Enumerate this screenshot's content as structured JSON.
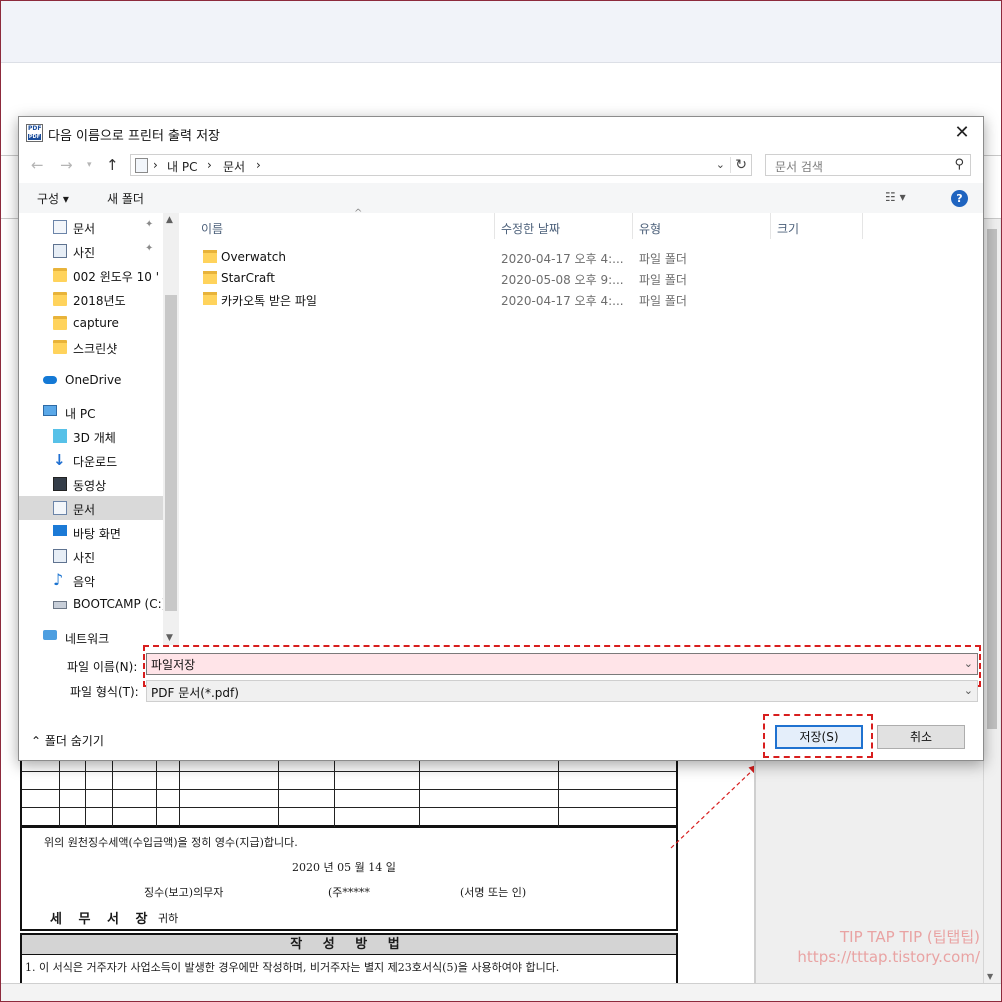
{
  "dialog": {
    "title": "다음 이름으로 프린터 출력 저장",
    "close_label": "✕"
  },
  "address": {
    "parts": [
      "내 PC",
      "문서"
    ],
    "search_placeholder": "문서 검색"
  },
  "cmdbar": {
    "organize": "구성 ▾",
    "new_folder": "새 폴더",
    "help": "?"
  },
  "nav": {
    "quick": [
      {
        "label": "문서",
        "icon": "document-icon",
        "pinned": true
      },
      {
        "label": "사진",
        "icon": "picture-icon",
        "pinned": true
      },
      {
        "label": "002 윈도우 10 '",
        "icon": "folder-icon"
      },
      {
        "label": "2018년도",
        "icon": "folder-icon"
      },
      {
        "label": "capture",
        "icon": "folder-icon"
      },
      {
        "label": "스크린샷",
        "icon": "folder-icon"
      }
    ],
    "onedrive": "OneDrive",
    "pc": "내 PC",
    "pc_items": [
      {
        "label": "3D 개체",
        "icon": "cube-icon"
      },
      {
        "label": "다운로드",
        "icon": "download-icon"
      },
      {
        "label": "동영상",
        "icon": "video-icon"
      },
      {
        "label": "문서",
        "icon": "document-icon",
        "selected": true
      },
      {
        "label": "바탕 화면",
        "icon": "desktop-icon"
      },
      {
        "label": "사진",
        "icon": "picture-icon"
      },
      {
        "label": "음악",
        "icon": "music-icon"
      },
      {
        "label": "BOOTCAMP (C:)",
        "icon": "drive-icon"
      }
    ],
    "network": "네트워크"
  },
  "columns": {
    "name": "이름",
    "modified": "수정한 날짜",
    "type": "유형",
    "size": "크기"
  },
  "files": [
    {
      "name": "Overwatch",
      "date": "2020-04-17 오후 4:...",
      "type": "파일 폴더"
    },
    {
      "name": "StarCraft",
      "date": "2020-05-08 오후 9:...",
      "type": "파일 폴더"
    },
    {
      "name": "카카오톡 받은 파일",
      "date": "2020-04-17 오후 4:...",
      "type": "파일 폴더"
    }
  ],
  "form": {
    "filename_label": "파일 이름(N):",
    "filename_value": "파일저장",
    "filetype_label": "파일 형식(T):",
    "filetype_value": "PDF 문서(*.pdf)"
  },
  "footer": {
    "hide_folders": "⌃  폴더 숨기기",
    "save": "저장(S)",
    "cancel": "취소"
  },
  "document": {
    "receipt_line": "위의 원천징수세액(수입금액)을 정히 영수(지급)합니다.",
    "date_line": "2020 년 05 월 14 일",
    "payer_label": "징수(보고)의무자",
    "payer_name": "(주*****",
    "sign_label": "(서명 또는 인)",
    "office": "세 무 서 장",
    "honorific": "귀하",
    "method_title": "작 성 방 법",
    "method_line1": "1. 이 서식은 거주자가 사업소득이 발생한 경우에만 작성하며, 비거주자는 별지 제23호서식(5)을 사용하여야 합니다."
  },
  "watermark": {
    "title": "TIP TAP TIP (팁탭팁)",
    "url": "https://tttap.tistory.com/"
  },
  "colors": {
    "highlight": "#d81e1e",
    "accent": "#1f72d0",
    "folder": "#ffd35c"
  }
}
